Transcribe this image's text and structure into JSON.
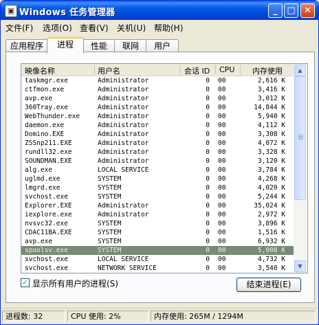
{
  "window": {
    "title": "Windows 任务管理器",
    "minimize_glyph": "_",
    "maximize_glyph": "□",
    "close_glyph": "✕"
  },
  "menu": [
    "文件(F)",
    "选项(O)",
    "查看(V)",
    "关机(U)",
    "帮助(H)"
  ],
  "tabs": [
    "应用程序",
    "进程",
    "性能",
    "联网",
    "用户"
  ],
  "active_tab": "进程",
  "columns": {
    "name": "映像名称",
    "user": "用户名",
    "session": "会话 ID",
    "cpu": "CPU",
    "mem": "内存使用"
  },
  "processes": [
    {
      "name": "taskmgr.exe",
      "user": "Administrator",
      "session": "0",
      "cpu": "00",
      "mem": "2,616 K"
    },
    {
      "name": "ctfmon.exe",
      "user": "Administrator",
      "session": "0",
      "cpu": "00",
      "mem": "3,416 K"
    },
    {
      "name": "avp.exe",
      "user": "Administrator",
      "session": "0",
      "cpu": "00",
      "mem": "3,012 K"
    },
    {
      "name": "360Tray.exe",
      "user": "Administrator",
      "session": "0",
      "cpu": "00",
      "mem": "14,844 K"
    },
    {
      "name": "WebThunder.exe",
      "user": "Administrator",
      "session": "0",
      "cpu": "00",
      "mem": "5,940 K"
    },
    {
      "name": "daemon.exe",
      "user": "Administrator",
      "session": "0",
      "cpu": "00",
      "mem": "4,112 K"
    },
    {
      "name": "Domino.EXE",
      "user": "Administrator",
      "session": "0",
      "cpu": "00",
      "mem": "3,308 K"
    },
    {
      "name": "ZSSnp211.EXE",
      "user": "Administrator",
      "session": "0",
      "cpu": "00",
      "mem": "4,072 K"
    },
    {
      "name": "rundll32.exe",
      "user": "Administrator",
      "session": "0",
      "cpu": "00",
      "mem": "3,328 K"
    },
    {
      "name": "SOUNDMAN.EXE",
      "user": "Administrator",
      "session": "0",
      "cpu": "00",
      "mem": "3,120 K"
    },
    {
      "name": "alg.exe",
      "user": "LOCAL SERVICE",
      "session": "0",
      "cpu": "00",
      "mem": "3,784 K"
    },
    {
      "name": "uglmd.exe",
      "user": "SYSTEM",
      "session": "0",
      "cpu": "00",
      "mem": "4,268 K"
    },
    {
      "name": "lmgrd.exe",
      "user": "SYSTEM",
      "session": "0",
      "cpu": "00",
      "mem": "4,020 K"
    },
    {
      "name": "svchost.exe",
      "user": "SYSTEM",
      "session": "0",
      "cpu": "00",
      "mem": "5,244 K"
    },
    {
      "name": "Explorer.EXE",
      "user": "Administrator",
      "session": "0",
      "cpu": "00",
      "mem": "35,024 K"
    },
    {
      "name": "iexplore.exe",
      "user": "Administrator",
      "session": "0",
      "cpu": "00",
      "mem": "2,972 K"
    },
    {
      "name": "nvsvc32.exe",
      "user": "SYSTEM",
      "session": "0",
      "cpu": "00",
      "mem": "3,896 K"
    },
    {
      "name": "CDAC11BA.EXE",
      "user": "SYSTEM",
      "session": "0",
      "cpu": "00",
      "mem": "1,516 K"
    },
    {
      "name": "avp.exe",
      "user": "SYSTEM",
      "session": "0",
      "cpu": "00",
      "mem": "6,932 K"
    },
    {
      "name": "spoolsv.exe",
      "user": "SYSTEM",
      "session": "0",
      "cpu": "00",
      "mem": "5,008 K",
      "selected": true
    },
    {
      "name": "svchost.exe",
      "user": "LOCAL SERVICE",
      "session": "0",
      "cpu": "00",
      "mem": "4,732 K"
    },
    {
      "name": "svchost.exe",
      "user": "NETWORK SERVICE",
      "session": "0",
      "cpu": "00",
      "mem": "3,540 K"
    }
  ],
  "show_all_users": {
    "label": "显示所有用户的进程(S)",
    "checked": true
  },
  "end_process_label": "结束进程(E)",
  "status": {
    "processes": "进程数: 32",
    "cpu": "CPU 使用: 2%",
    "memory": "内存使用: 265M / 1294M"
  },
  "colors": {
    "selected_row": "#7a8a77",
    "titlebar": "#0a5ee8"
  }
}
